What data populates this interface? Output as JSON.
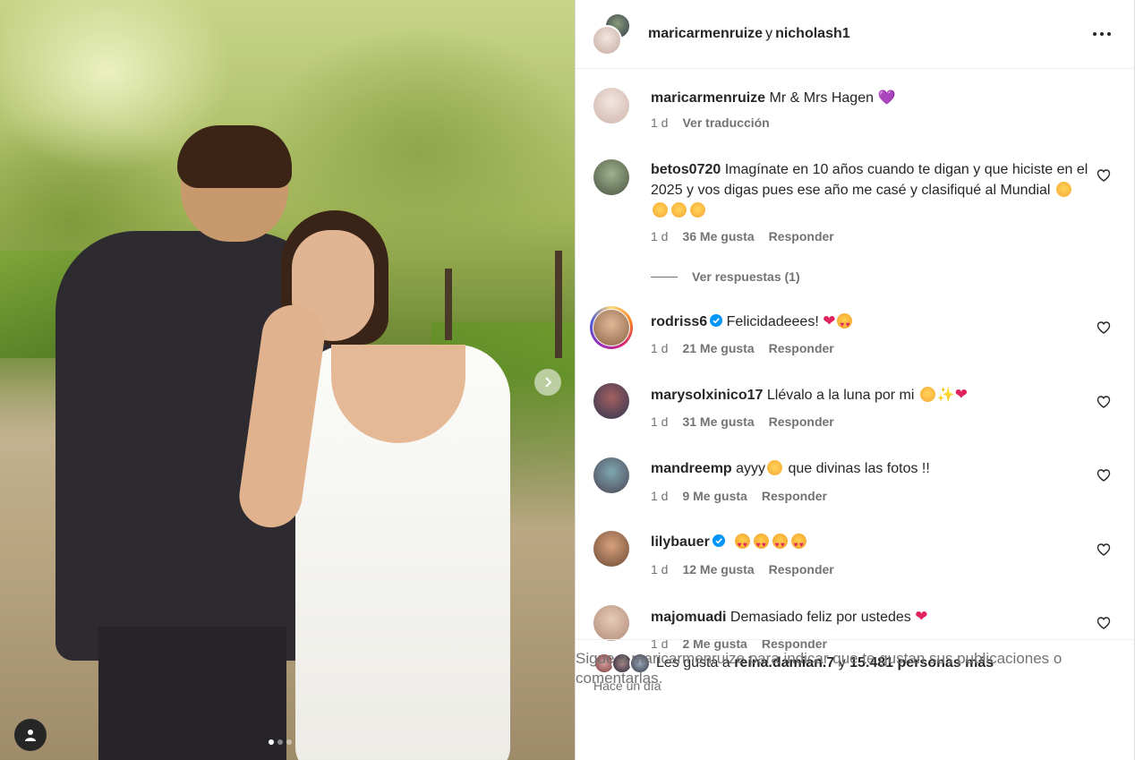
{
  "header": {
    "user1": "maricarmenruize",
    "joiner": "y",
    "user2": "nicholash1"
  },
  "comments": [
    {
      "user": "maricarmenruize",
      "text": "Mr & Mrs Hagen",
      "time": "1 d",
      "action": "Ver traducción",
      "emoji_suffix": "💜"
    },
    {
      "user": "betos0720",
      "text": "Imagínate en 10 años cuando te digan y que hiciste en el 2025 y vos digas pues ese año me casé y clasifiqué al Mundial",
      "time": "1 d",
      "likes": "36 Me gusta",
      "reply": "Responder"
    },
    {
      "user": "rodriss6",
      "text": "Felicidadeees!",
      "time": "1 d",
      "likes": "21 Me gusta",
      "reply": "Responder"
    },
    {
      "user": "marysolxinico17",
      "text": "Llévalo a la luna por mi",
      "time": "1 d",
      "likes": "31 Me gusta",
      "reply": "Responder"
    },
    {
      "user": "mandreemp",
      "text_a": "ayyy",
      "text_b": " que divinas las fotos !!",
      "time": "1 d",
      "likes": "9 Me gusta",
      "reply": "Responder"
    },
    {
      "user": "lilybauer",
      "time": "1 d",
      "likes": "12 Me gusta",
      "reply": "Responder"
    },
    {
      "user": "majomuadi",
      "text": "Demasiado feliz por ustedes",
      "time": "1 d",
      "likes": "2 Me gusta",
      "reply": "Responder"
    }
  ],
  "view_replies": "Ver respuestas (1)",
  "likes": {
    "prefix": "Les gusta a",
    "user": "reina.damian.7",
    "joiner": "y",
    "count": "15.481 personas más"
  },
  "time_ago": "Hace un día",
  "footer": {
    "text": "Sigue a maricarmenruize para indicar que te gustan sus publicaciones o comentarlas."
  },
  "colors": {
    "verified": "#0095f6",
    "muted": "#737373",
    "text": "#262626"
  },
  "icons": [
    "more-icon",
    "heart-icon",
    "verified-icon",
    "chevron-right-icon",
    "user-tag-icon"
  ],
  "carousel": {
    "current": 1,
    "total": 3
  }
}
